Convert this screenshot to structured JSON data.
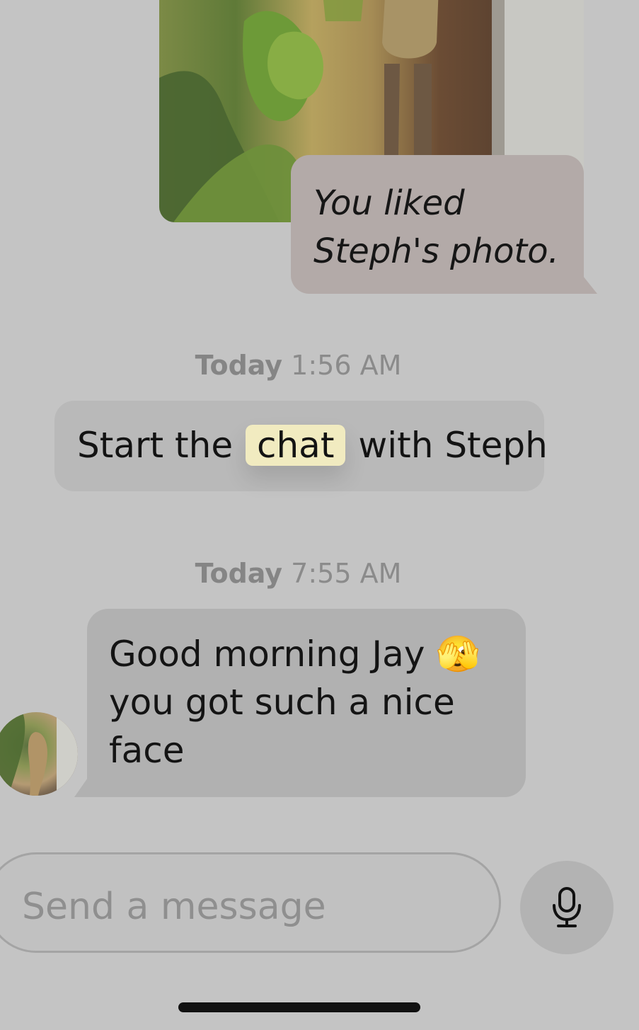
{
  "liked_photo": {
    "text_line1": "You liked",
    "text_line2": "Steph's photo."
  },
  "timestamps": [
    {
      "day": "Today",
      "time": "1:56 AM"
    },
    {
      "day": "Today",
      "time": "7:55 AM"
    }
  ],
  "start_chat": {
    "before": "Start the",
    "highlight": "chat",
    "after": "with Steph"
  },
  "message": {
    "line1": "Good morning Jay",
    "emoji": "🫣",
    "line2": "you got such a nice",
    "line3": "face"
  },
  "composer": {
    "placeholder": "Send a message"
  },
  "icons": {
    "mic": "microphone-icon"
  },
  "colors": {
    "background": "#c4c4c4",
    "highlight": "#f1ebc0"
  }
}
